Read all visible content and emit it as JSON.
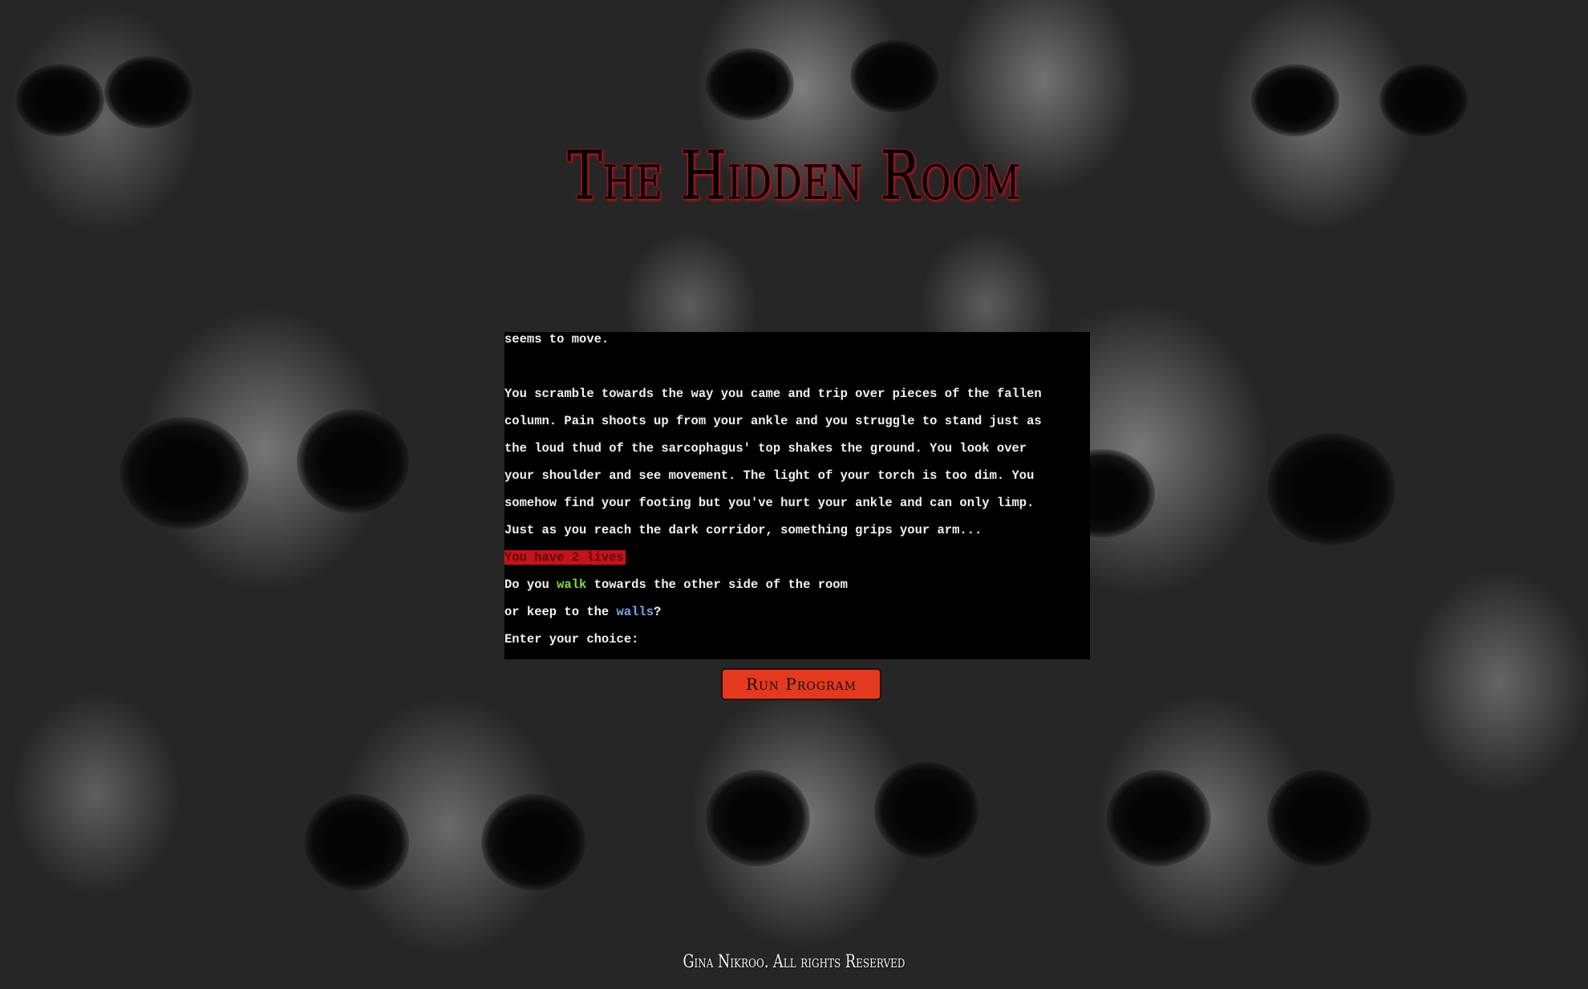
{
  "page": {
    "title": "The Hidden Room",
    "footer": "Gina Nikroo. All rights Reserved"
  },
  "terminal": {
    "lines": [
      "seems to move.",
      "",
      "You scramble towards the way you came and trip over pieces of the fallen",
      "column. Pain shoots up from your ankle and you struggle to stand just as",
      "the loud thud of the sarcophagus' top shakes the ground. You look over",
      "your shoulder and see movement. The light of your torch is too dim. You",
      "somehow find your footing but you've hurt your ankle and can only limp.",
      "Just as you reach the dark corridor, something grips your arm..."
    ],
    "lives_text": "You have 2 lives",
    "choice_line_1": {
      "prefix": "Do you ",
      "keyword": "walk",
      "suffix": " towards the other side of the room"
    },
    "choice_line_2": {
      "prefix": "or keep to the ",
      "keyword": "walls",
      "suffix": "?"
    },
    "prompt": "Enter your choice:"
  },
  "controls": {
    "run_button_label": "Run Program"
  },
  "colors": {
    "title_glow": "#e0101a",
    "lives_bg": "#c8121b",
    "walk_keyword": "#7ddf3f",
    "walls_keyword": "#7aa7e6",
    "button_bg": "#e5391f"
  }
}
